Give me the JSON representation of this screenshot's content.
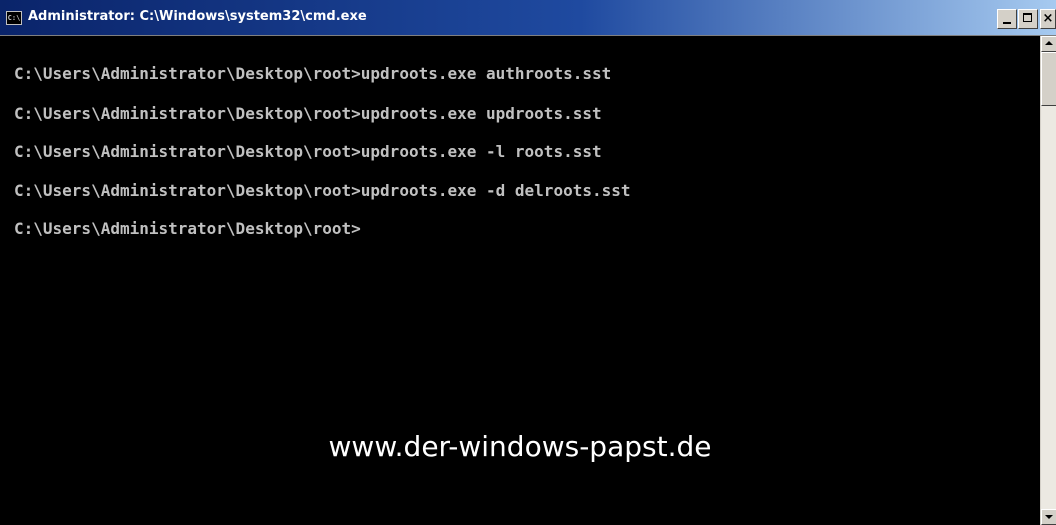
{
  "window": {
    "title": "Administrator: C:\\Windows\\system32\\cmd.exe",
    "icon_name": "cmd-icon",
    "icon_text": "C:\\"
  },
  "titlebar_buttons": {
    "close_glyph": "×"
  },
  "console": {
    "lines": [
      "C:\\Users\\Administrator\\Desktop\\root>updroots.exe authroots.sst",
      "C:\\Users\\Administrator\\Desktop\\root>updroots.exe updroots.sst",
      "C:\\Users\\Administrator\\Desktop\\root>updroots.exe -l roots.sst",
      "C:\\Users\\Administrator\\Desktop\\root>updroots.exe -d delroots.sst",
      "C:\\Users\\Administrator\\Desktop\\root>"
    ],
    "text_color": "#c0c0c0",
    "background_color": "#000000"
  },
  "watermark": {
    "text": "www.der-windows-papst.de"
  }
}
